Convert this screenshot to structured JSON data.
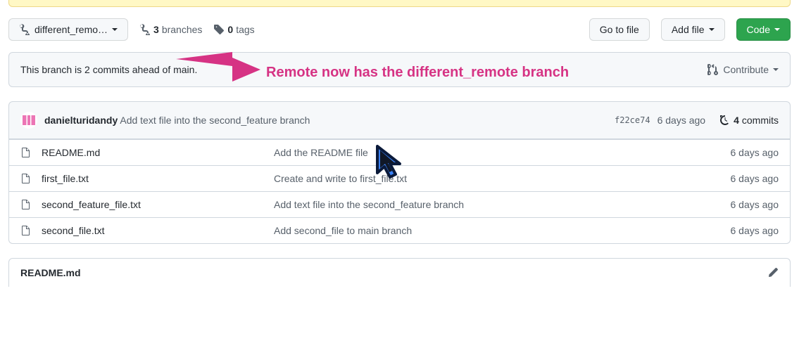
{
  "branch_selector": {
    "name": "different_remo…"
  },
  "meta": {
    "branches_count": "3",
    "branches_label": "branches",
    "tags_count": "0",
    "tags_label": "tags"
  },
  "actions": {
    "go_to_file": "Go to file",
    "add_file": "Add file",
    "code": "Code"
  },
  "annotation": "Remote now has the different_remote branch",
  "status": {
    "text": "This branch is 2 commits ahead of main.",
    "contribute": "Contribute"
  },
  "commit": {
    "author": "danielturidandy",
    "message": "Add text file into the second_feature branch",
    "hash": "f22ce74",
    "time": "6 days ago",
    "count_number": "4",
    "count_label": "commits"
  },
  "files": [
    {
      "name": "README.md",
      "msg": "Add the README file",
      "time": "6 days ago"
    },
    {
      "name": "first_file.txt",
      "msg": "Create and write to first_file.txt",
      "time": "6 days ago"
    },
    {
      "name": "second_feature_file.txt",
      "msg": "Add text file into the second_feature branch",
      "time": "6 days ago"
    },
    {
      "name": "second_file.txt",
      "msg": "Add second_file to main branch",
      "time": "6 days ago"
    }
  ],
  "readme": {
    "title": "README.md"
  }
}
